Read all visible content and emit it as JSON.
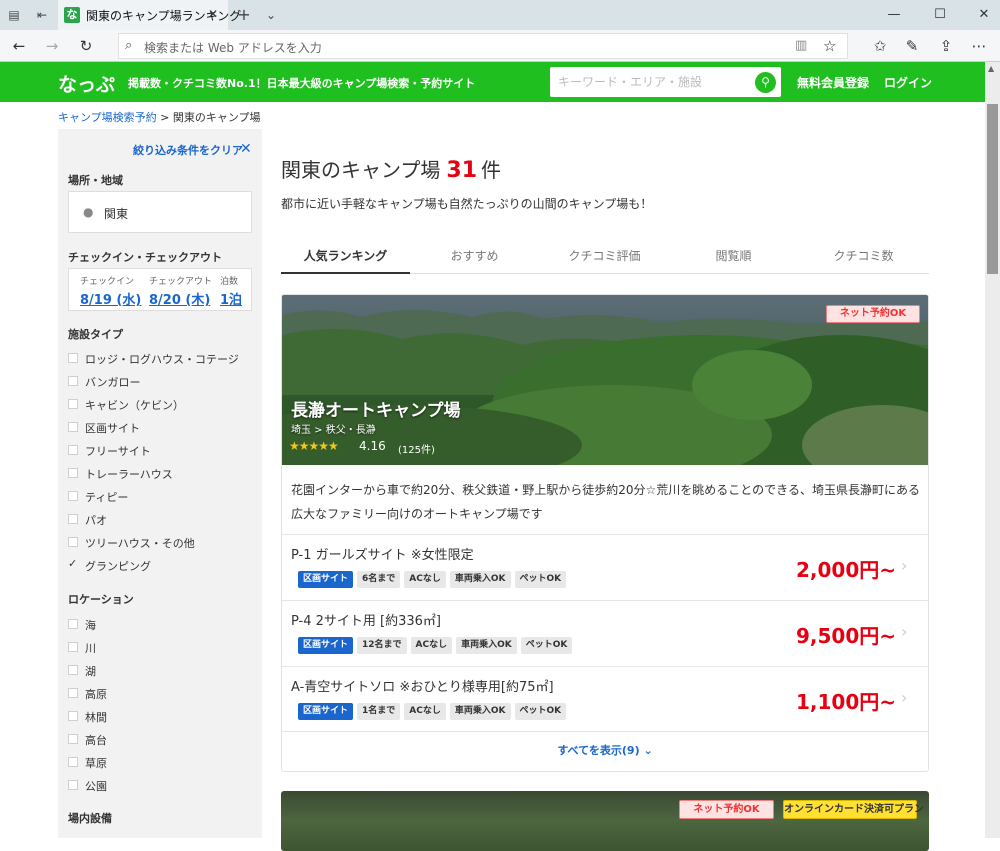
{
  "browser": {
    "tab_title": "関東のキャンプ場ランキング",
    "favicon_text": "な",
    "address_placeholder": "検索または Web アドレスを入力"
  },
  "header": {
    "logo": "なっぷ",
    "tagline": "掲載数・クチコミ数No.1！日本最大級のキャンプ場検索・予約サイト",
    "search_placeholder": "キーワード・エリア・施設",
    "register": "無料会員登録",
    "login": "ログイン",
    "brand_color": "#1fbf1f"
  },
  "breadcrumb": {
    "home": "キャンプ場検索予約",
    "separator": ">",
    "current": "関東のキャンプ場"
  },
  "sidebar": {
    "clear_label": "絞り込み条件をクリア",
    "area_heading": "場所・地域",
    "area_value": "関東",
    "checkin_heading": "チェックイン・チェックアウト",
    "checkin_label": "チェックイン",
    "checkin_value": "8/19 (水)",
    "checkout_label": "チェックアウト",
    "checkout_value": "8/20 (木)",
    "nights_label": "泊数",
    "nights_value": "1泊",
    "facility_heading": "施設タイプ",
    "facility_types": [
      {
        "label": "ロッジ・ログハウス・コテージ",
        "checked": false
      },
      {
        "label": "バンガロー",
        "checked": false
      },
      {
        "label": "キャビン（ケビン）",
        "checked": false
      },
      {
        "label": "区画サイト",
        "checked": false
      },
      {
        "label": "フリーサイト",
        "checked": false
      },
      {
        "label": "トレーラーハウス",
        "checked": false
      },
      {
        "label": "ティピー",
        "checked": false
      },
      {
        "label": "パオ",
        "checked": false
      },
      {
        "label": "ツリーハウス・その他",
        "checked": false
      },
      {
        "label": "グランピング",
        "checked": true
      }
    ],
    "location_heading": "ロケーション",
    "locations": [
      {
        "label": "海",
        "checked": false
      },
      {
        "label": "川",
        "checked": false
      },
      {
        "label": "湖",
        "checked": false
      },
      {
        "label": "高原",
        "checked": false
      },
      {
        "label": "林間",
        "checked": false
      },
      {
        "label": "高台",
        "checked": false
      },
      {
        "label": "草原",
        "checked": false
      },
      {
        "label": "公園",
        "checked": false
      }
    ],
    "equipment_heading": "場内設備"
  },
  "main": {
    "title_prefix": "関東のキャンプ場",
    "count": "31",
    "count_suffix": "件",
    "description": "都市に近い手軽なキャンプ場も自然たっぷりの山間のキャンプ場も！",
    "sort_tabs": [
      "人気ランキング",
      "おすすめ",
      "クチコミ評価",
      "閲覧順",
      "クチコミ数"
    ],
    "active_tab": 0
  },
  "card": {
    "badge": "ネット予約OK",
    "name": "長瀞オートキャンプ場",
    "location": "埼玉 > 秩父・長瀞",
    "stars": "★★★★★",
    "rating": "4.16",
    "rating_value": 4.16,
    "reviews": "(125件)",
    "description": "花園インターから車で約20分、秩父鉄道・野上駅から徒歩約20分☆荒川を眺めることのできる、埼玉県長瀞町にある広大なファミリー向けのオートキャンプ場です",
    "sites": [
      {
        "name": "P-1 ガールズサイト ※女性限定",
        "tags": [
          "区画サイト",
          "6名まで",
          "ACなし",
          "車両乗入OK",
          "ペットOK"
        ],
        "price": "2,000円~"
      },
      {
        "name": "P-4 2サイト用 [約336㎡]",
        "tags": [
          "区画サイト",
          "12名まで",
          "ACなし",
          "車両乗入OK",
          "ペットOK"
        ],
        "price": "9,500円~"
      },
      {
        "name": "A-青空サイトソロ ※おひとり様専用[約75㎡]",
        "tags": [
          "区画サイト",
          "1名まで",
          "ACなし",
          "車両乗入OK",
          "ペットOK"
        ],
        "price": "1,100円~"
      }
    ],
    "show_all": "すべてを表示(9)"
  },
  "card2": {
    "badge_net": "ネット予約OK",
    "badge_card": "オンラインカード決済可プラン"
  }
}
